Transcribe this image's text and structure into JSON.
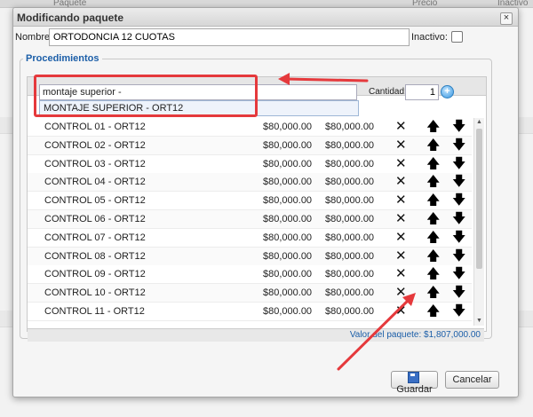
{
  "background": {
    "col_headers": [
      "Paquete",
      "Precio",
      "Inactivo"
    ]
  },
  "dialog": {
    "title": "Modificando paquete",
    "close_label": "×"
  },
  "form": {
    "name_label": "Nombre:",
    "name_value": "ORTODONCIA 12 CUOTAS",
    "inactive_label": "Inactivo:",
    "inactive_checked": false
  },
  "procedures": {
    "legend": "Procedimientos",
    "search_value": "montaje superior -",
    "suggestion": "MONTAJE SUPERIOR - ORT12",
    "qty_label": "Cantidad:",
    "qty_value": "1",
    "add_label": "+",
    "rows": [
      {
        "name": "CONTROL 01 - ORT12",
        "price": "$80,000.00",
        "total": "$80,000.00"
      },
      {
        "name": "CONTROL 02 - ORT12",
        "price": "$80,000.00",
        "total": "$80,000.00"
      },
      {
        "name": "CONTROL 03 - ORT12",
        "price": "$80,000.00",
        "total": "$80,000.00"
      },
      {
        "name": "CONTROL 04 - ORT12",
        "price": "$80,000.00",
        "total": "$80,000.00"
      },
      {
        "name": "CONTROL 05 - ORT12",
        "price": "$80,000.00",
        "total": "$80,000.00"
      },
      {
        "name": "CONTROL 06 - ORT12",
        "price": "$80,000.00",
        "total": "$80,000.00"
      },
      {
        "name": "CONTROL 07 - ORT12",
        "price": "$80,000.00",
        "total": "$80,000.00"
      },
      {
        "name": "CONTROL 08 - ORT12",
        "price": "$80,000.00",
        "total": "$80,000.00"
      },
      {
        "name": "CONTROL 09 - ORT12",
        "price": "$80,000.00",
        "total": "$80,000.00"
      },
      {
        "name": "CONTROL 10 - ORT12",
        "price": "$80,000.00",
        "total": "$80,000.00"
      },
      {
        "name": "CONTROL 11 - ORT12",
        "price": "$80,000.00",
        "total": "$80,000.00"
      }
    ],
    "delete_glyph": "✕",
    "up_glyph": "🡅",
    "down_glyph": "🡇",
    "total_text": "Valor del paquete: $1,807,000.00"
  },
  "buttons": {
    "save_label": "Guardar",
    "cancel_label": "Cancelar"
  },
  "annotation": {
    "color": "#e5393c"
  }
}
